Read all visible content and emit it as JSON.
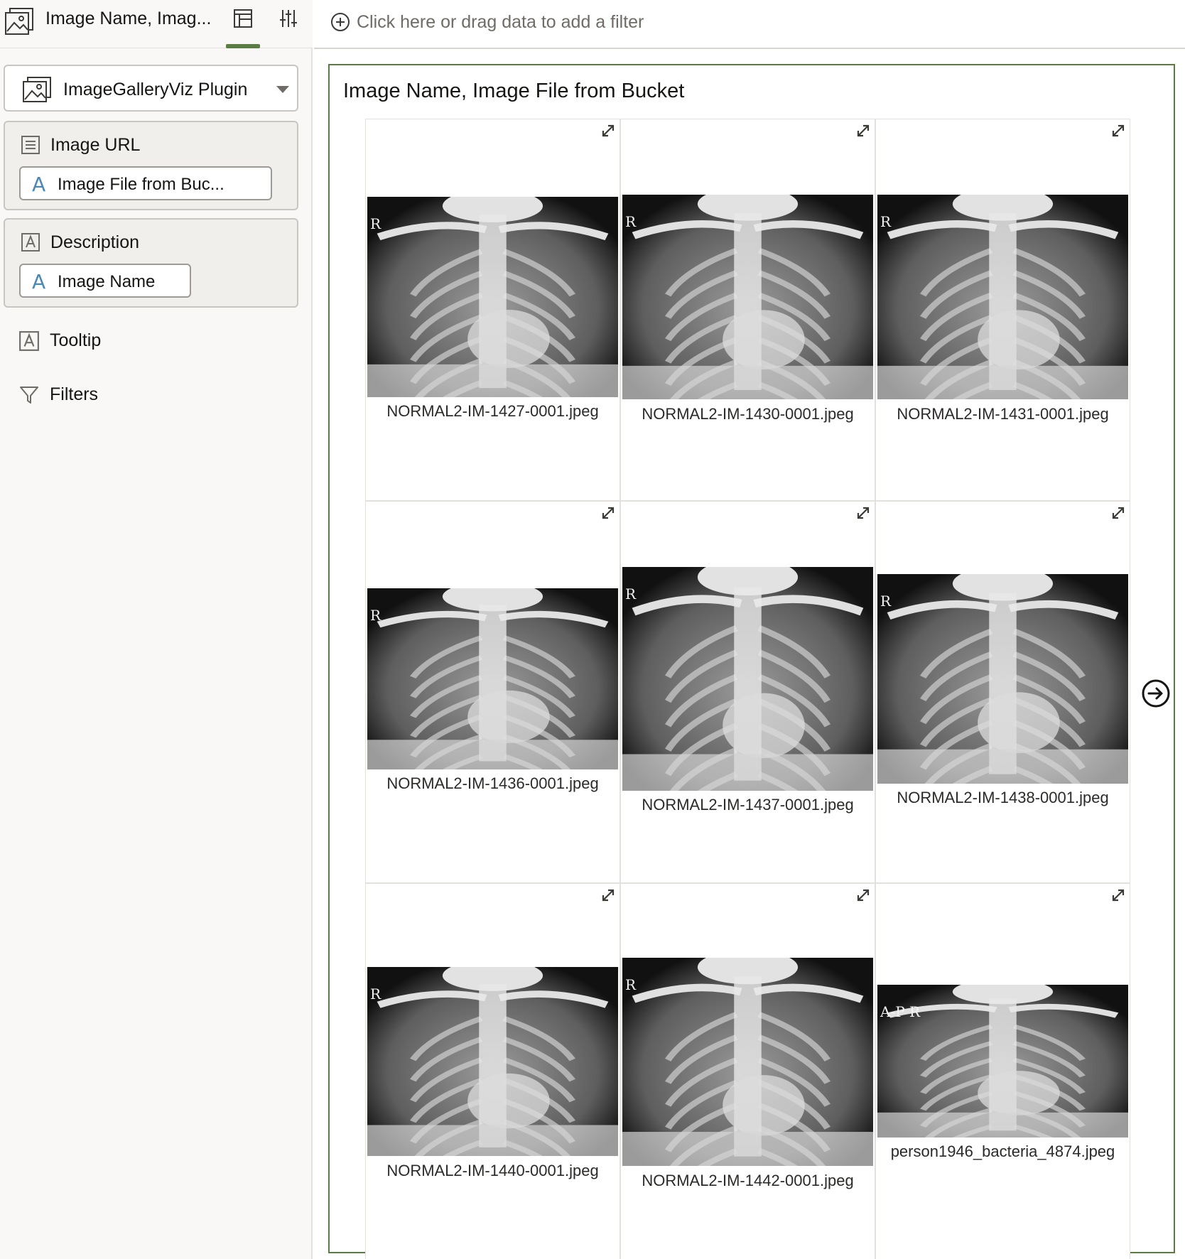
{
  "left_panel": {
    "header": {
      "title": "Image Name, Imag..."
    },
    "viz_type": {
      "label": "ImageGalleryViz Plugin"
    },
    "sections": {
      "image_url": {
        "label": "Image URL",
        "pill": "Image File from Buc..."
      },
      "description": {
        "label": "Description",
        "pill": "Image Name"
      }
    },
    "tooltip": {
      "label": "Tooltip"
    },
    "filters": {
      "label": "Filters"
    }
  },
  "filter_bar": {
    "text": "Click here or drag data to add a filter"
  },
  "visualization": {
    "title": "Image Name, Image File from Bucket",
    "images": [
      {
        "name": "NORMAL2-IM-1427-0001.jpeg",
        "marker": "R"
      },
      {
        "name": "NORMAL2-IM-1430-0001.jpeg",
        "marker": "R"
      },
      {
        "name": "NORMAL2-IM-1431-0001.jpeg",
        "marker": "R"
      },
      {
        "name": "NORMAL2-IM-1436-0001.jpeg",
        "marker": "R"
      },
      {
        "name": "NORMAL2-IM-1437-0001.jpeg",
        "marker": "R"
      },
      {
        "name": "NORMAL2-IM-1438-0001.jpeg",
        "marker": "R"
      },
      {
        "name": "NORMAL2-IM-1440-0001.jpeg",
        "marker": "R"
      },
      {
        "name": "NORMAL2-IM-1442-0001.jpeg",
        "marker": "R"
      },
      {
        "name": "person1946_bacteria_4874.jpeg",
        "marker": "A-P R"
      }
    ]
  },
  "icons": {
    "viz_icon": "image-gallery-icon",
    "grammar_icon": "grammar-panel-icon",
    "properties_icon": "sliders-icon",
    "add_filter_icon": "plus-circle-icon",
    "expand_icon": "expand-icon",
    "next_icon": "arrow-right-circle-icon"
  },
  "colors": {
    "accent": "#5b7d45",
    "attribute_icon": "#4a89b5"
  }
}
